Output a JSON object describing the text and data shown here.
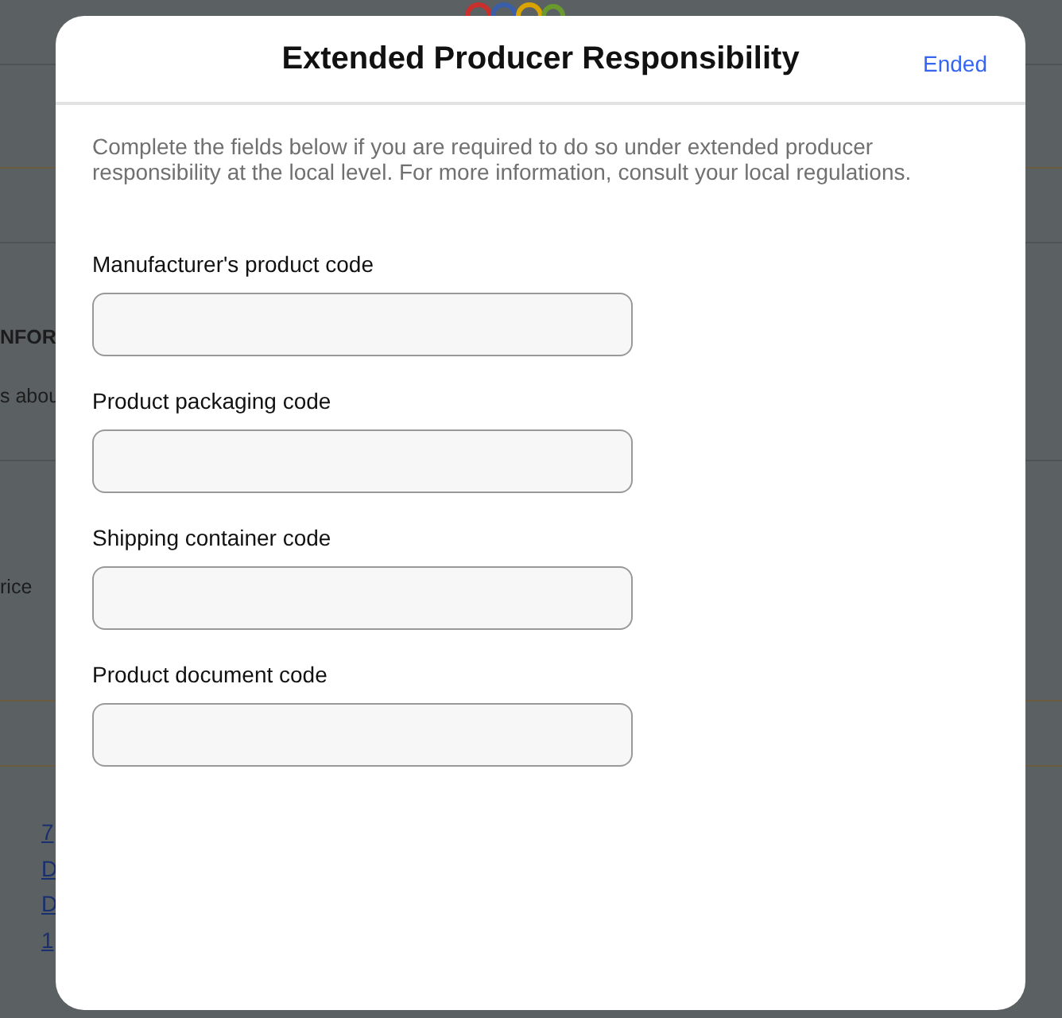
{
  "background_page": {
    "heading": "NFOR",
    "subtext": "s abou",
    "price_label": "rice",
    "links": [
      "7",
      "D",
      "D",
      "1"
    ]
  },
  "dialog": {
    "title": "Extended Producer Responsibility",
    "action": "Ended",
    "description": "Complete the fields below if you are required to do so under extended producer responsibility at the local level. For more information, consult your local regulations.",
    "fields": [
      {
        "label": "Manufacturer's product code"
      },
      {
        "label": "Product packaging code"
      },
      {
        "label": "Shipping container code"
      },
      {
        "label": "Product document code"
      }
    ]
  }
}
